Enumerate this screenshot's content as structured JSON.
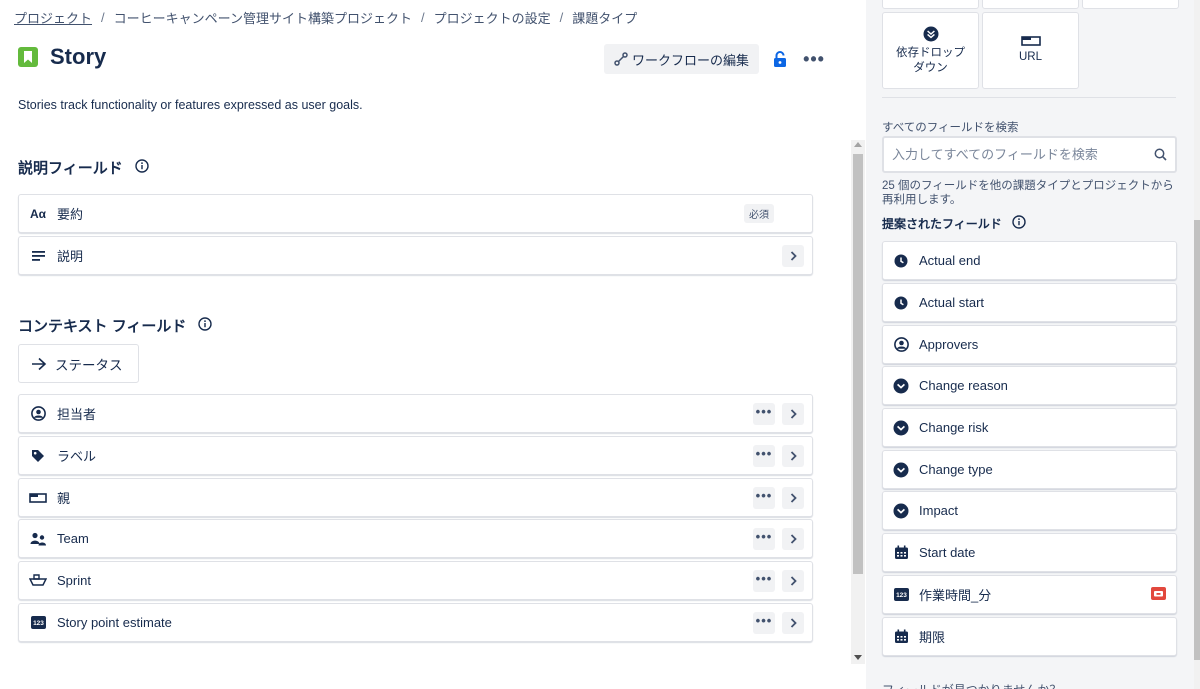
{
  "breadcrumb": {
    "items": [
      "プロジェクト",
      "コーヒーキャンペーン管理サイト構築プロジェクト",
      "プロジェクトの設定",
      "課題タイプ"
    ],
    "separator": "/"
  },
  "page": {
    "title": "Story",
    "description": "Stories track functionality or features expressed as user goals.",
    "icon": "story-icon",
    "icon_color": "#63ba3c"
  },
  "header": {
    "workflow_button": "ワークフローの編集",
    "lock_icon": "lock-icon",
    "more_label": "•••"
  },
  "description_fields": {
    "title": "説明フィールド",
    "items": [
      {
        "label": "要約",
        "icon": "text-aa-icon",
        "badge": "必須"
      },
      {
        "label": "説明",
        "icon": "paragraph-icon"
      }
    ]
  },
  "context_fields": {
    "title": "コンテキスト フィールド",
    "status_label": "ステータス",
    "items": [
      {
        "label": "担当者",
        "icon": "person-icon"
      },
      {
        "label": "ラベル",
        "icon": "tag-icon"
      },
      {
        "label": "親",
        "icon": "parent-icon"
      },
      {
        "label": "Team",
        "icon": "team-icon"
      },
      {
        "label": "Sprint",
        "icon": "sprint-icon"
      },
      {
        "label": "Story point estimate",
        "icon": "number-icon"
      }
    ]
  },
  "right_panel": {
    "tiles": [
      {
        "label": "依存ドロップダウン",
        "icon": "dropdown-circle-icon"
      },
      {
        "label": "URL",
        "icon": "url-field-icon"
      }
    ],
    "search_label": "すべてのフィールドを検索",
    "search_placeholder": "入力してすべてのフィールドを検索",
    "reuse_note": "25 個のフィールドを他の課題タイプとプロジェクトから再利用します。",
    "suggested_title": "提案されたフィールド",
    "suggested": [
      {
        "label": "Actual end",
        "icon": "clock-icon"
      },
      {
        "label": "Actual start",
        "icon": "clock-icon"
      },
      {
        "label": "Approvers",
        "icon": "person-icon"
      },
      {
        "label": "Change reason",
        "icon": "dropdown-circle-icon"
      },
      {
        "label": "Change risk",
        "icon": "dropdown-circle-icon"
      },
      {
        "label": "Change type",
        "icon": "dropdown-circle-icon"
      },
      {
        "label": "Impact",
        "icon": "dropdown-circle-icon"
      },
      {
        "label": "Start date",
        "icon": "calendar-icon"
      },
      {
        "label": "作業時間_分",
        "icon": "number-icon",
        "badge": "app-badge-icon"
      },
      {
        "label": "期限",
        "icon": "calendar-icon"
      }
    ],
    "bottom_text": "フィールドが見つかりませんか？"
  },
  "colors": {
    "text": "#172b4d",
    "subtle": "#42526e",
    "lock": "#0c66e4",
    "badge": "#e2483d",
    "panel_bg": "#f4f5f7"
  }
}
